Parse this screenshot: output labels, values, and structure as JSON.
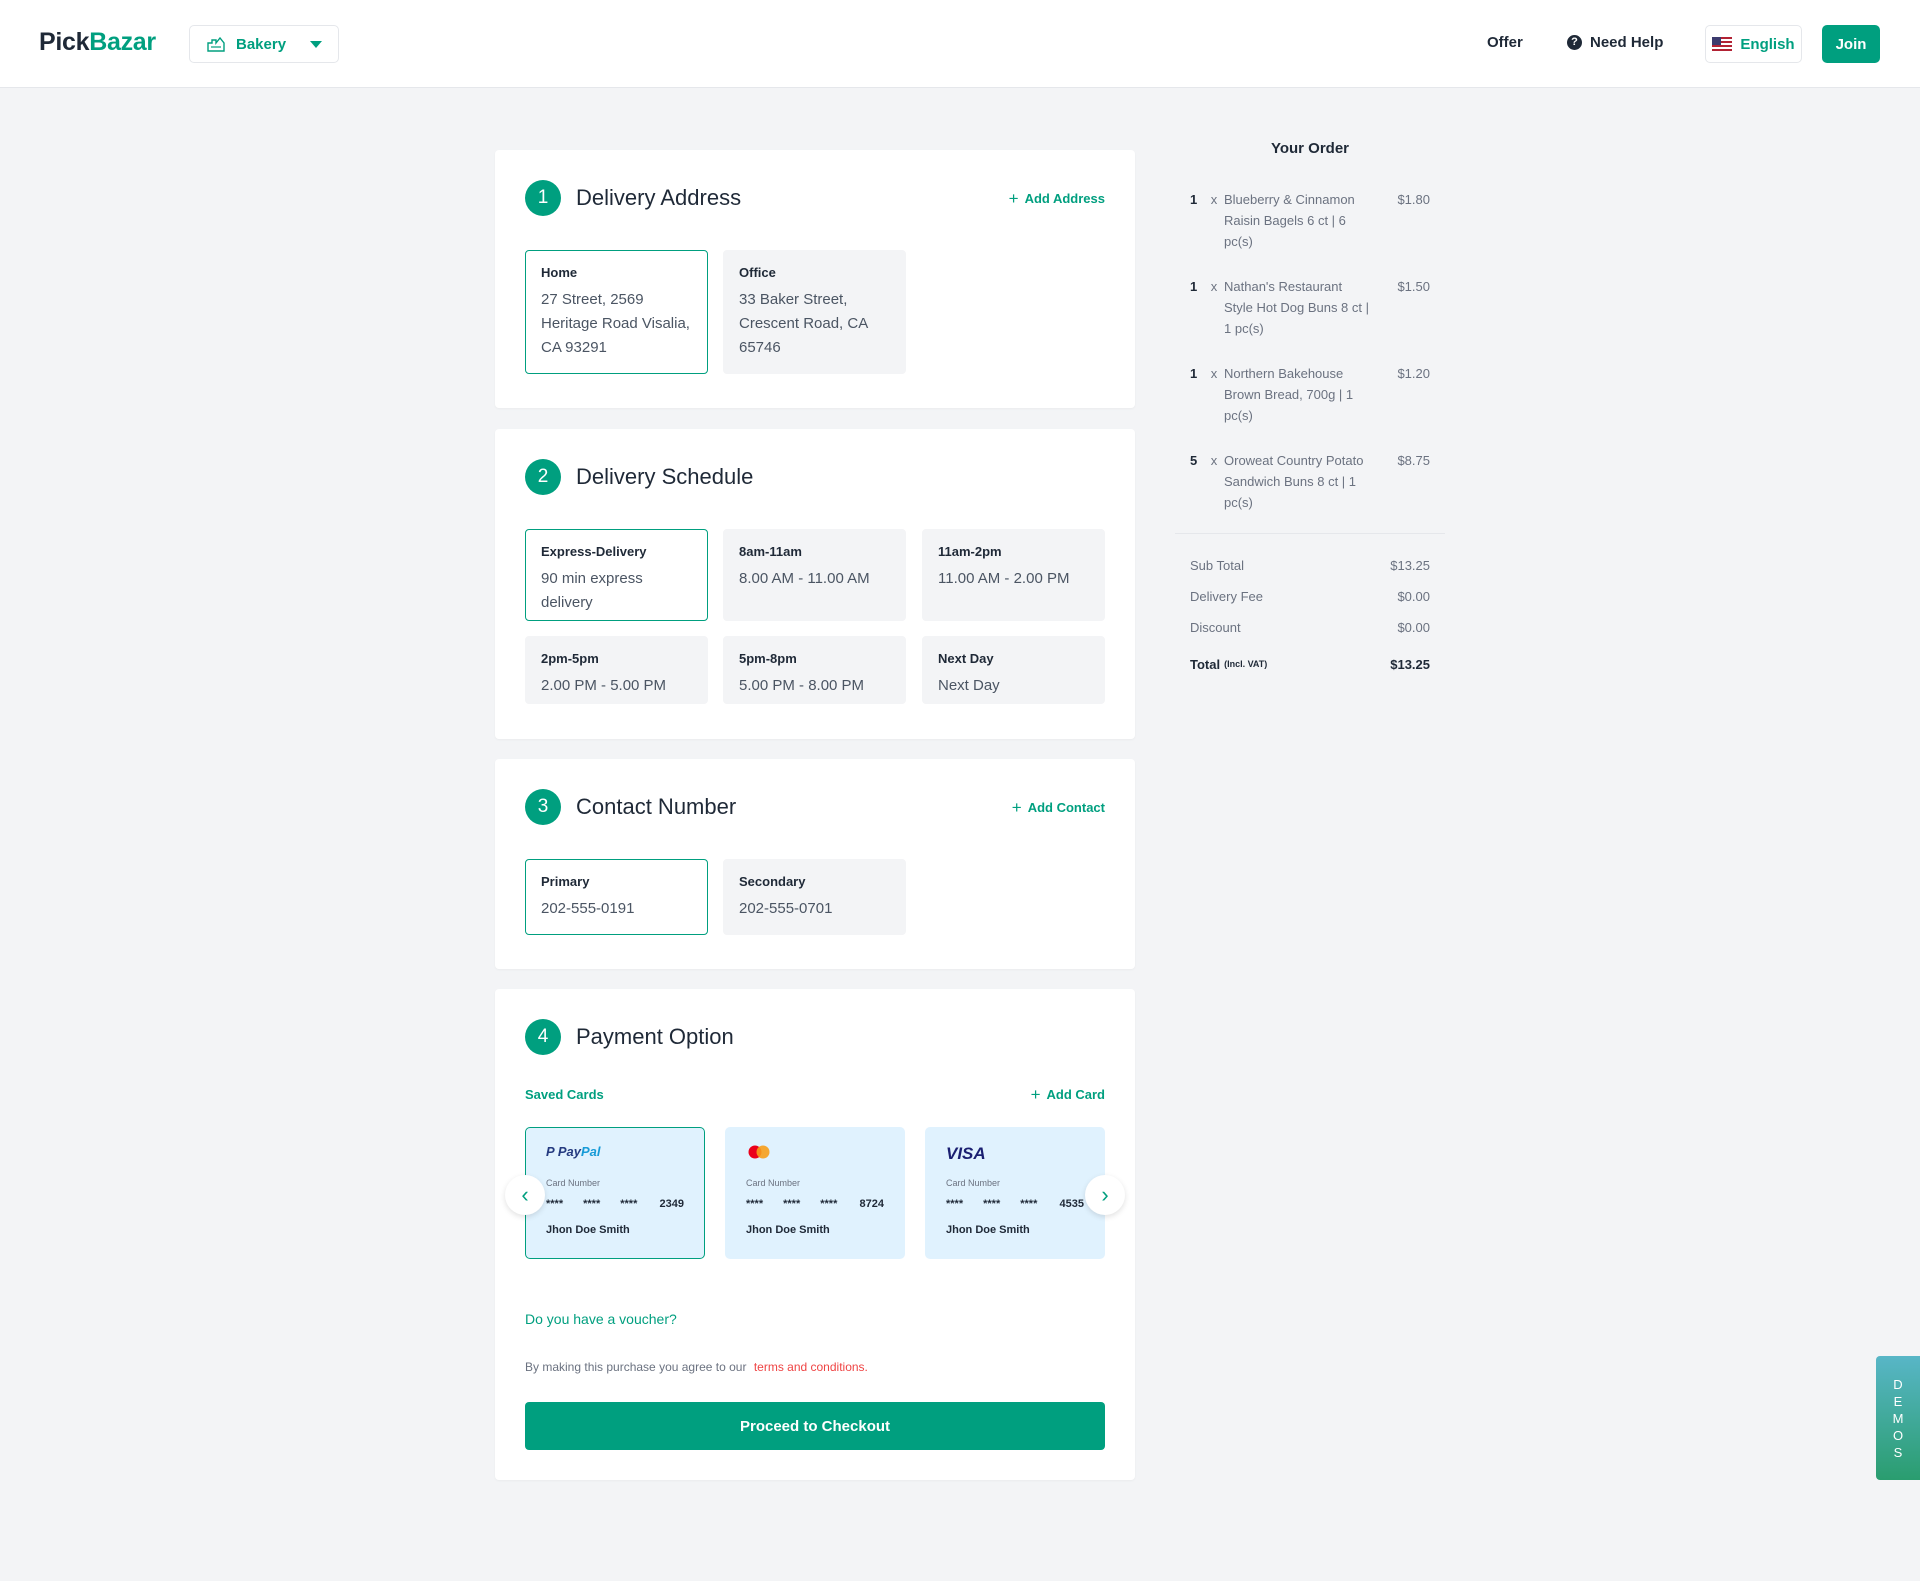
{
  "header": {
    "logo_main": "Pick",
    "logo_accent": "Bazar",
    "shop_label": "Bakery",
    "offer_label": "Offer",
    "help_label": "Need Help",
    "language_label": "English",
    "join_label": "Join"
  },
  "delivery_address": {
    "step": "1",
    "title": "Delivery Address",
    "add_label": "Add Address",
    "options": [
      {
        "title": "Home",
        "desc": "27 Street, 2569 Heritage Road Visalia, CA 93291",
        "selected": true
      },
      {
        "title": "Office",
        "desc": "33 Baker Street, Crescent Road, CA 65746",
        "selected": false
      }
    ]
  },
  "delivery_schedule": {
    "step": "2",
    "title": "Delivery Schedule",
    "options": [
      {
        "title": "Express-Delivery",
        "desc": "90 min express delivery",
        "selected": true
      },
      {
        "title": "8am-11am",
        "desc": "8.00 AM - 11.00 AM",
        "selected": false
      },
      {
        "title": "11am-2pm",
        "desc": "11.00 AM - 2.00 PM",
        "selected": false
      },
      {
        "title": "2pm-5pm",
        "desc": "2.00 PM - 5.00 PM",
        "selected": false
      },
      {
        "title": "5pm-8pm",
        "desc": "5.00 PM - 8.00 PM",
        "selected": false
      },
      {
        "title": "Next Day",
        "desc": "Next Day",
        "selected": false
      }
    ]
  },
  "contact_number": {
    "step": "3",
    "title": "Contact Number",
    "add_label": "Add Contact",
    "options": [
      {
        "title": "Primary",
        "desc": "202-555-0191",
        "selected": true
      },
      {
        "title": "Secondary",
        "desc": "202-555-0701",
        "selected": false
      }
    ]
  },
  "payment": {
    "step": "4",
    "title": "Payment Option",
    "saved_label": "Saved Cards",
    "add_label": "Add Card",
    "cards": [
      {
        "brand": "PayPal",
        "card_number_label": "Card Number",
        "mask": "****",
        "last4": "2349",
        "holder": "Jhon Doe Smith",
        "selected": true
      },
      {
        "brand": "Mastercard",
        "card_number_label": "Card Number",
        "mask": "****",
        "last4": "8724",
        "holder": "Jhon Doe Smith",
        "selected": false
      },
      {
        "brand": "VISA",
        "card_number_label": "Card Number",
        "mask": "****",
        "last4": "4535",
        "holder": "Jhon Doe Smith",
        "selected": false
      }
    ],
    "voucher_label": "Do you have a voucher?",
    "terms_text": "By making this purchase you agree to our",
    "terms_link": "terms and conditions.",
    "checkout_label": "Proceed to Checkout"
  },
  "order": {
    "title": "Your Order",
    "items": [
      {
        "qty": "1",
        "x": "x",
        "name": "Blueberry & Cinnamon Raisin Bagels 6 ct | 6 pc(s)",
        "price": "$1.80"
      },
      {
        "qty": "1",
        "x": "x",
        "name": "Nathan's Restaurant Style Hot Dog Buns 8 ct | 1 pc(s)",
        "price": "$1.50"
      },
      {
        "qty": "1",
        "x": "x",
        "name": "Northern Bakehouse Brown Bread, 700g | 1 pc(s)",
        "price": "$1.20"
      },
      {
        "qty": "5",
        "x": "x",
        "name": "Oroweat Country Potato Sandwich Buns 8 ct | 1 pc(s)",
        "price": "$8.75"
      }
    ],
    "sub_total_label": "Sub Total",
    "sub_total": "$13.25",
    "delivery_fee_label": "Delivery Fee",
    "delivery_fee": "$0.00",
    "discount_label": "Discount",
    "discount": "$0.00",
    "total_label": "Total",
    "total_note": "(Incl. VAT)",
    "total": "$13.25"
  },
  "demos": {
    "letters": [
      "D",
      "E",
      "M",
      "O",
      "S"
    ]
  },
  "colors": {
    "accent": "#009f7f",
    "card_bg": "#e0f2fe",
    "link_red": "#ef4444"
  },
  "icons": [
    "bakery-icon",
    "chevron-down-icon",
    "help-icon",
    "us-flag-icon",
    "plus-icon",
    "paypal-icon",
    "mastercard-icon",
    "visa-icon",
    "chevron-left-icon",
    "chevron-right-icon"
  ]
}
